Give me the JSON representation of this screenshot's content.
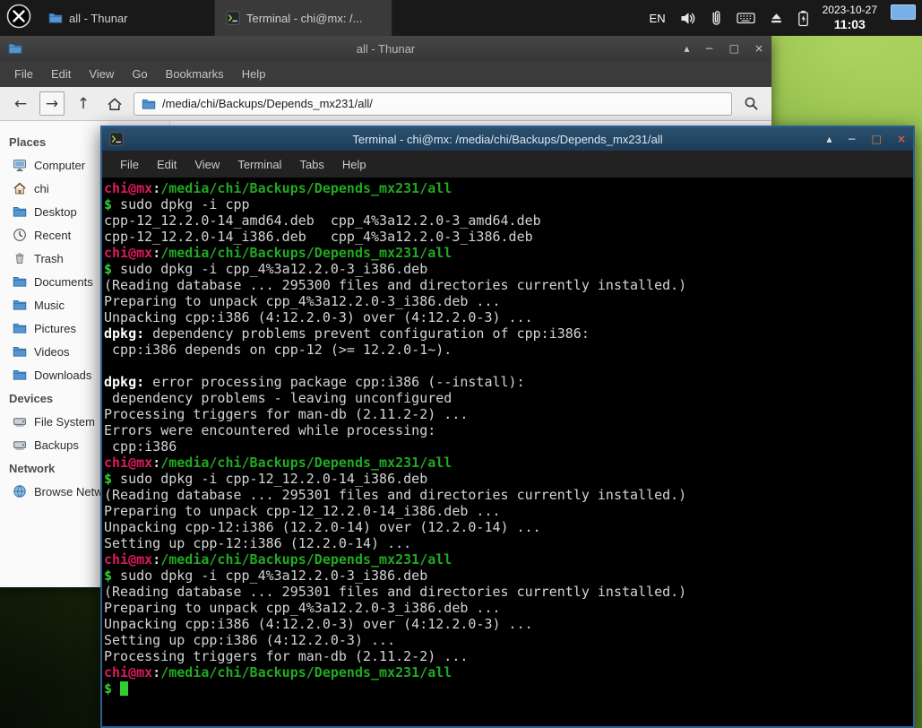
{
  "panel": {
    "tasks": [
      {
        "label": "all - Thunar",
        "icon": "thunar-icon",
        "active": false
      },
      {
        "label": "Terminal - chi@mx: /...",
        "icon": "terminal-icon",
        "active": true
      }
    ],
    "keyboard_layout": "EN",
    "tray_icons": [
      "volume-icon",
      "clipboard-icon",
      "keyboard-icon",
      "eject-icon",
      "battery-icon"
    ],
    "date": "2023-10-27",
    "time": "11:03"
  },
  "window_controls": {
    "shade": "▴",
    "minimize": "−",
    "maximize": "□",
    "close": "×"
  },
  "toolbar_icons": {
    "back": "←",
    "forward": "→",
    "up": "↑",
    "home": "home-icon",
    "search": "search-icon"
  },
  "thunar": {
    "title": "all - Thunar",
    "menu": [
      "File",
      "Edit",
      "View",
      "Go",
      "Bookmarks",
      "Help"
    ],
    "location": "/media/chi/Backups/Depends_mx231/all/",
    "sidebar": {
      "sections": [
        {
          "header": "Places",
          "items": [
            {
              "label": "Computer",
              "icon": "computer"
            },
            {
              "label": "chi",
              "icon": "home"
            },
            {
              "label": "Desktop",
              "icon": "folder"
            },
            {
              "label": "Recent",
              "icon": "clock"
            },
            {
              "label": "Trash",
              "icon": "trash"
            },
            {
              "label": "Documents",
              "icon": "folder"
            },
            {
              "label": "Music",
              "icon": "folder"
            },
            {
              "label": "Pictures",
              "icon": "folder"
            },
            {
              "label": "Videos",
              "icon": "folder"
            },
            {
              "label": "Downloads",
              "icon": "folder"
            }
          ]
        },
        {
          "header": "Devices",
          "items": [
            {
              "label": "File System",
              "icon": "drive"
            },
            {
              "label": "Backups",
              "icon": "drive"
            }
          ]
        },
        {
          "header": "Network",
          "items": [
            {
              "label": "Browse Network",
              "icon": "network"
            }
          ]
        }
      ]
    }
  },
  "terminal": {
    "title": "Terminal - chi@mx: /media/chi/Backups/Depends_mx231/all",
    "menu": [
      "File",
      "Edit",
      "View",
      "Terminal",
      "Tabs",
      "Help"
    ],
    "prompt_user": "chi@mx",
    "prompt_path": "/media/chi/Backups/Depends_mx231/all",
    "lines": [
      [
        [
          "u",
          "chi@mx"
        ],
        [
          "w",
          ":"
        ],
        [
          "p",
          "/media/chi/Backups/Depends_mx231/all"
        ]
      ],
      [
        [
          "g",
          "$"
        ],
        [
          "t",
          " sudo dpkg -i cpp"
        ]
      ],
      [
        [
          "t",
          "cpp-12_12.2.0-14_amd64.deb  cpp_4%3a12.2.0-3_amd64.deb"
        ]
      ],
      [
        [
          "t",
          "cpp-12_12.2.0-14_i386.deb   cpp_4%3a12.2.0-3_i386.deb"
        ]
      ],
      [
        [
          "u",
          "chi@mx"
        ],
        [
          "w",
          ":"
        ],
        [
          "p",
          "/media/chi/Backups/Depends_mx231/all"
        ]
      ],
      [
        [
          "g",
          "$"
        ],
        [
          "t",
          " sudo dpkg -i cpp_4%3a12.2.0-3_i386.deb"
        ]
      ],
      [
        [
          "t",
          "(Reading database ... 295300 files and directories currently installed.)"
        ]
      ],
      [
        [
          "t",
          "Preparing to unpack cpp_4%3a12.2.0-3_i386.deb ..."
        ]
      ],
      [
        [
          "t",
          "Unpacking cpp:i386 (4:12.2.0-3) over (4:12.2.0-3) ..."
        ]
      ],
      [
        [
          "b",
          "dpkg:"
        ],
        [
          "t",
          " dependency problems prevent configuration of cpp:i386:"
        ]
      ],
      [
        [
          "t",
          " cpp:i386 depends on cpp-12 (>= 12.2.0-1~)."
        ]
      ],
      [],
      [
        [
          "b",
          "dpkg:"
        ],
        [
          "t",
          " error processing package cpp:i386 (--install):"
        ]
      ],
      [
        [
          "t",
          " dependency problems - leaving unconfigured"
        ]
      ],
      [
        [
          "t",
          "Processing triggers for man-db (2.11.2-2) ..."
        ]
      ],
      [
        [
          "t",
          "Errors were encountered while processing:"
        ]
      ],
      [
        [
          "t",
          " cpp:i386"
        ]
      ],
      [
        [
          "u",
          "chi@mx"
        ],
        [
          "w",
          ":"
        ],
        [
          "p",
          "/media/chi/Backups/Depends_mx231/all"
        ]
      ],
      [
        [
          "g",
          "$"
        ],
        [
          "t",
          " sudo dpkg -i cpp-12_12.2.0-14_i386.deb"
        ]
      ],
      [
        [
          "t",
          "(Reading database ... 295301 files and directories currently installed.)"
        ]
      ],
      [
        [
          "t",
          "Preparing to unpack cpp-12_12.2.0-14_i386.deb ..."
        ]
      ],
      [
        [
          "t",
          "Unpacking cpp-12:i386 (12.2.0-14) over (12.2.0-14) ..."
        ]
      ],
      [
        [
          "t",
          "Setting up cpp-12:i386 (12.2.0-14) ..."
        ]
      ],
      [
        [
          "u",
          "chi@mx"
        ],
        [
          "w",
          ":"
        ],
        [
          "p",
          "/media/chi/Backups/Depends_mx231/all"
        ]
      ],
      [
        [
          "g",
          "$"
        ],
        [
          "t",
          " sudo dpkg -i cpp_4%3a12.2.0-3_i386.deb"
        ]
      ],
      [
        [
          "t",
          "(Reading database ... 295301 files and directories currently installed.)"
        ]
      ],
      [
        [
          "t",
          "Preparing to unpack cpp_4%3a12.2.0-3_i386.deb ..."
        ]
      ],
      [
        [
          "t",
          "Unpacking cpp:i386 (4:12.2.0-3) over (4:12.2.0-3) ..."
        ]
      ],
      [
        [
          "t",
          "Setting up cpp:i386 (4:12.2.0-3) ..."
        ]
      ],
      [
        [
          "t",
          "Processing triggers for man-db (2.11.2-2) ..."
        ]
      ],
      [
        [
          "u",
          "chi@mx"
        ],
        [
          "w",
          ":"
        ],
        [
          "p",
          "/media/chi/Backups/Depends_mx231/all"
        ]
      ],
      [
        [
          "g",
          "$ "
        ],
        [
          "cursor",
          ""
        ]
      ]
    ]
  },
  "colors": {
    "prompt_user": "#d81b60",
    "prompt_path": "#22a822",
    "prompt_dollar": "#33cc33",
    "terminal_fg": "#d4d4d4",
    "terminal_bg": "#000000",
    "terminal_titlebar": "#23486a",
    "panel_bg": "#191919"
  }
}
